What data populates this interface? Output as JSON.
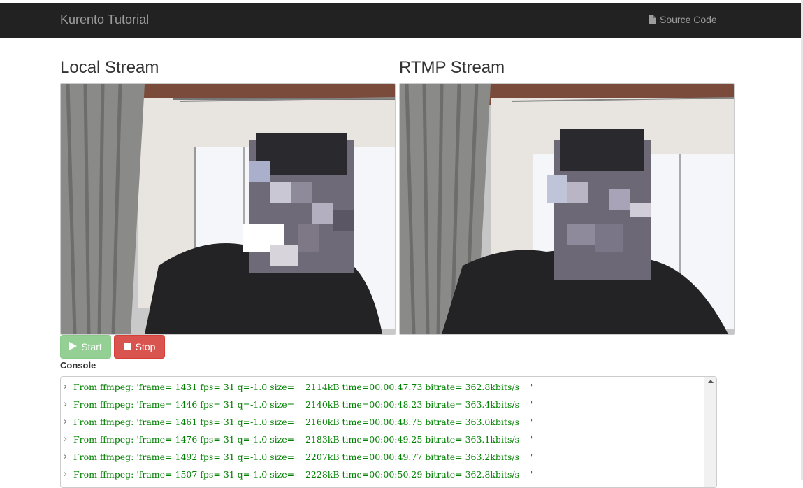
{
  "navbar": {
    "brand": "Kurento Tutorial",
    "source_code_label": "Source Code",
    "source_code_icon": "file-icon"
  },
  "streams": {
    "local_title": "Local Stream",
    "rtmp_title": "RTMP Stream"
  },
  "buttons": {
    "start_label": "Start",
    "start_icon": "play-icon",
    "stop_label": "Stop",
    "stop_icon": "stop-icon",
    "start_color": "#5cb85c",
    "stop_color": "#d9534f"
  },
  "console": {
    "label": "Console",
    "lines": [
      "From ffmpeg: 'frame= 1431 fps= 31 q=-1.0 size=    2114kB time=00:00:47.73 bitrate= 362.8kbits/s    '",
      "From ffmpeg: 'frame= 1446 fps= 31 q=-1.0 size=    2140kB time=00:00:48.23 bitrate= 363.4kbits/s    '",
      "From ffmpeg: 'frame= 1461 fps= 31 q=-1.0 size=    2160kB time=00:00:48.75 bitrate= 363.0kbits/s    '",
      "From ffmpeg: 'frame= 1476 fps= 31 q=-1.0 size=    2183kB time=00:00:49.25 bitrate= 363.1kbits/s    '",
      "From ffmpeg: 'frame= 1492 fps= 31 q=-1.0 size=    2207kB time=00:00:49.77 bitrate= 363.2kbits/s    '",
      "From ffmpeg: 'frame= 1507 fps= 31 q=-1.0 size=    2228kB time=00:00:50.29 bitrate= 362.8kbits/s    '"
    ],
    "text_color": "#008000"
  },
  "colors": {
    "navbar_bg": "#222222",
    "navbar_text": "#9d9d9d"
  }
}
